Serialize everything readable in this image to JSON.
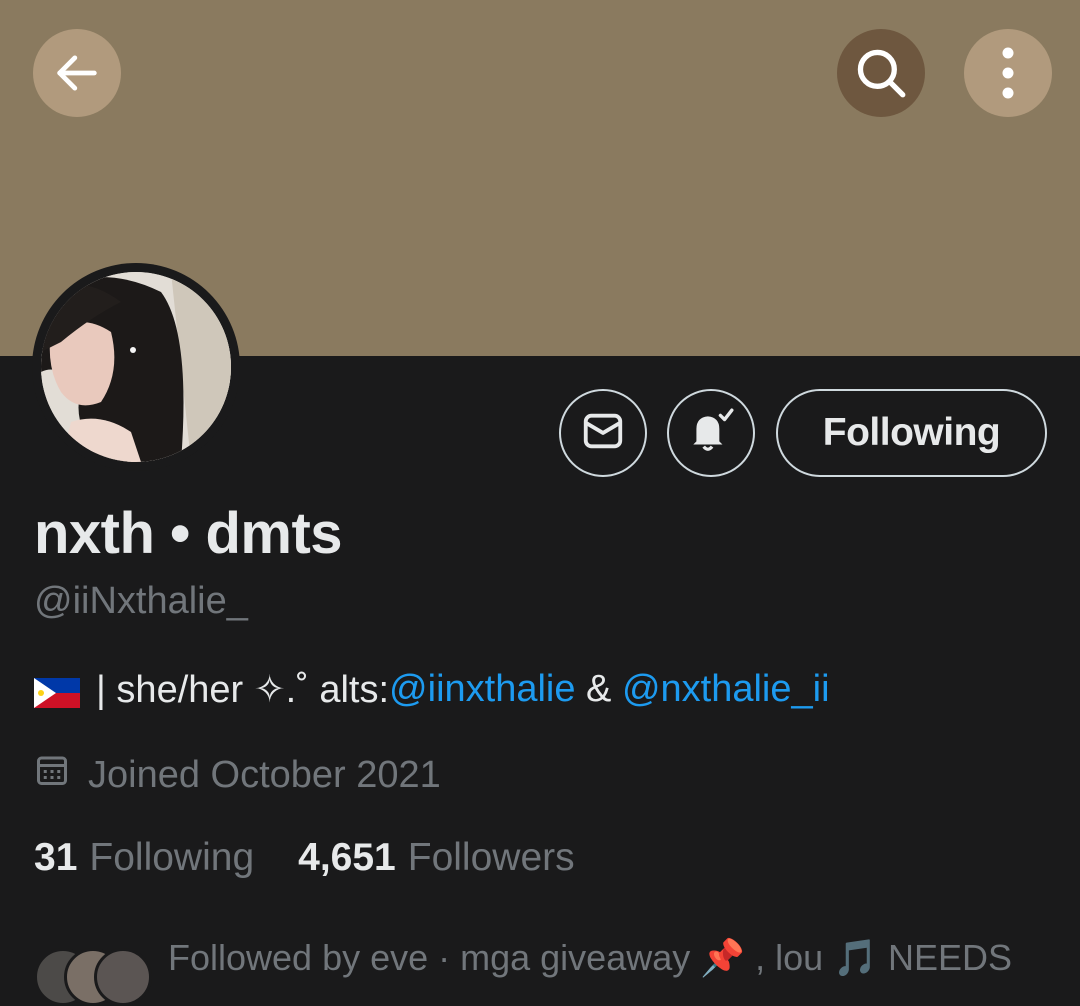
{
  "header": {
    "back_icon": "arrow-left-icon",
    "search_icon": "search-icon",
    "more_icon": "more-vertical-icon",
    "banner_color": "#8a7a5f"
  },
  "profile": {
    "display_name": "nxth • dmts",
    "handle": "@iiNxthalie_",
    "bio": {
      "flag": "philippines-flag",
      "text": " | she/her ✧.˚ alts: ",
      "mention1": "@iinxthalie",
      "separator": " & ",
      "mention2": "@nxthalie_ii"
    },
    "joined": "Joined October 2021",
    "stats": {
      "following_count": "31",
      "following_label": "Following",
      "followers_count": "4,651",
      "followers_label": "Followers"
    },
    "followed_by_text": "Followed by eve · mga giveaway 📌 , lou 🎵 NEEDS"
  },
  "actions": {
    "message_icon": "mail-icon",
    "notification_icon": "bell-subscribed-icon",
    "follow_label": "Following"
  },
  "colors": {
    "accent": "#1d9bf0",
    "background": "#1a1a1b",
    "muted": "#71767b"
  }
}
